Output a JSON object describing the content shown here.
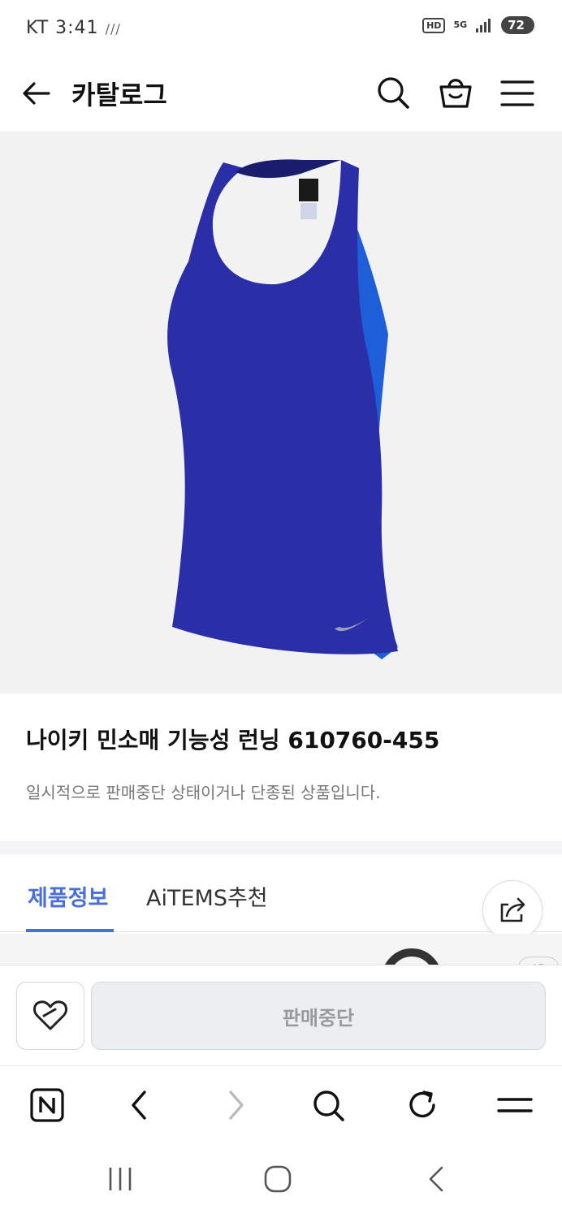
{
  "status_bar": {
    "carrier_time": "KT 3:41",
    "signal_glyph": "///",
    "hd": "HD",
    "network": "5G",
    "battery": "72"
  },
  "header": {
    "title": "카탈로그",
    "icons": [
      "back-arrow-icon",
      "search-icon",
      "shopping-bag-icon",
      "hamburger-menu-icon"
    ]
  },
  "product": {
    "name": "나이키 민소매 기능성 런닝 610760-455",
    "status_text": "일시적으로 판매중단 상태이거나 단종된 상품입니다.",
    "image_colors": {
      "primary": "#2a2fa8",
      "side_panel": "#1e5ed8",
      "background": "#f2f2f2"
    }
  },
  "tabs": [
    {
      "label": "제품정보",
      "active": true
    },
    {
      "label": "AiTEMS추천",
      "active": false
    }
  ],
  "peek": {
    "ad_label": "AD"
  },
  "action_bar": {
    "sold_out_label": "판매중단",
    "wish_icon": "heart-tag-icon"
  },
  "browser_nav": {
    "icons": [
      "naver-n-icon",
      "back-chevron-icon",
      "forward-chevron-icon",
      "search-icon",
      "refresh-icon",
      "menu-icon"
    ]
  },
  "system_nav": {
    "icons": [
      "recent-apps-icon",
      "home-icon",
      "back-icon"
    ]
  },
  "colors": {
    "accent": "#4a6fd6",
    "text_muted": "#777777"
  }
}
